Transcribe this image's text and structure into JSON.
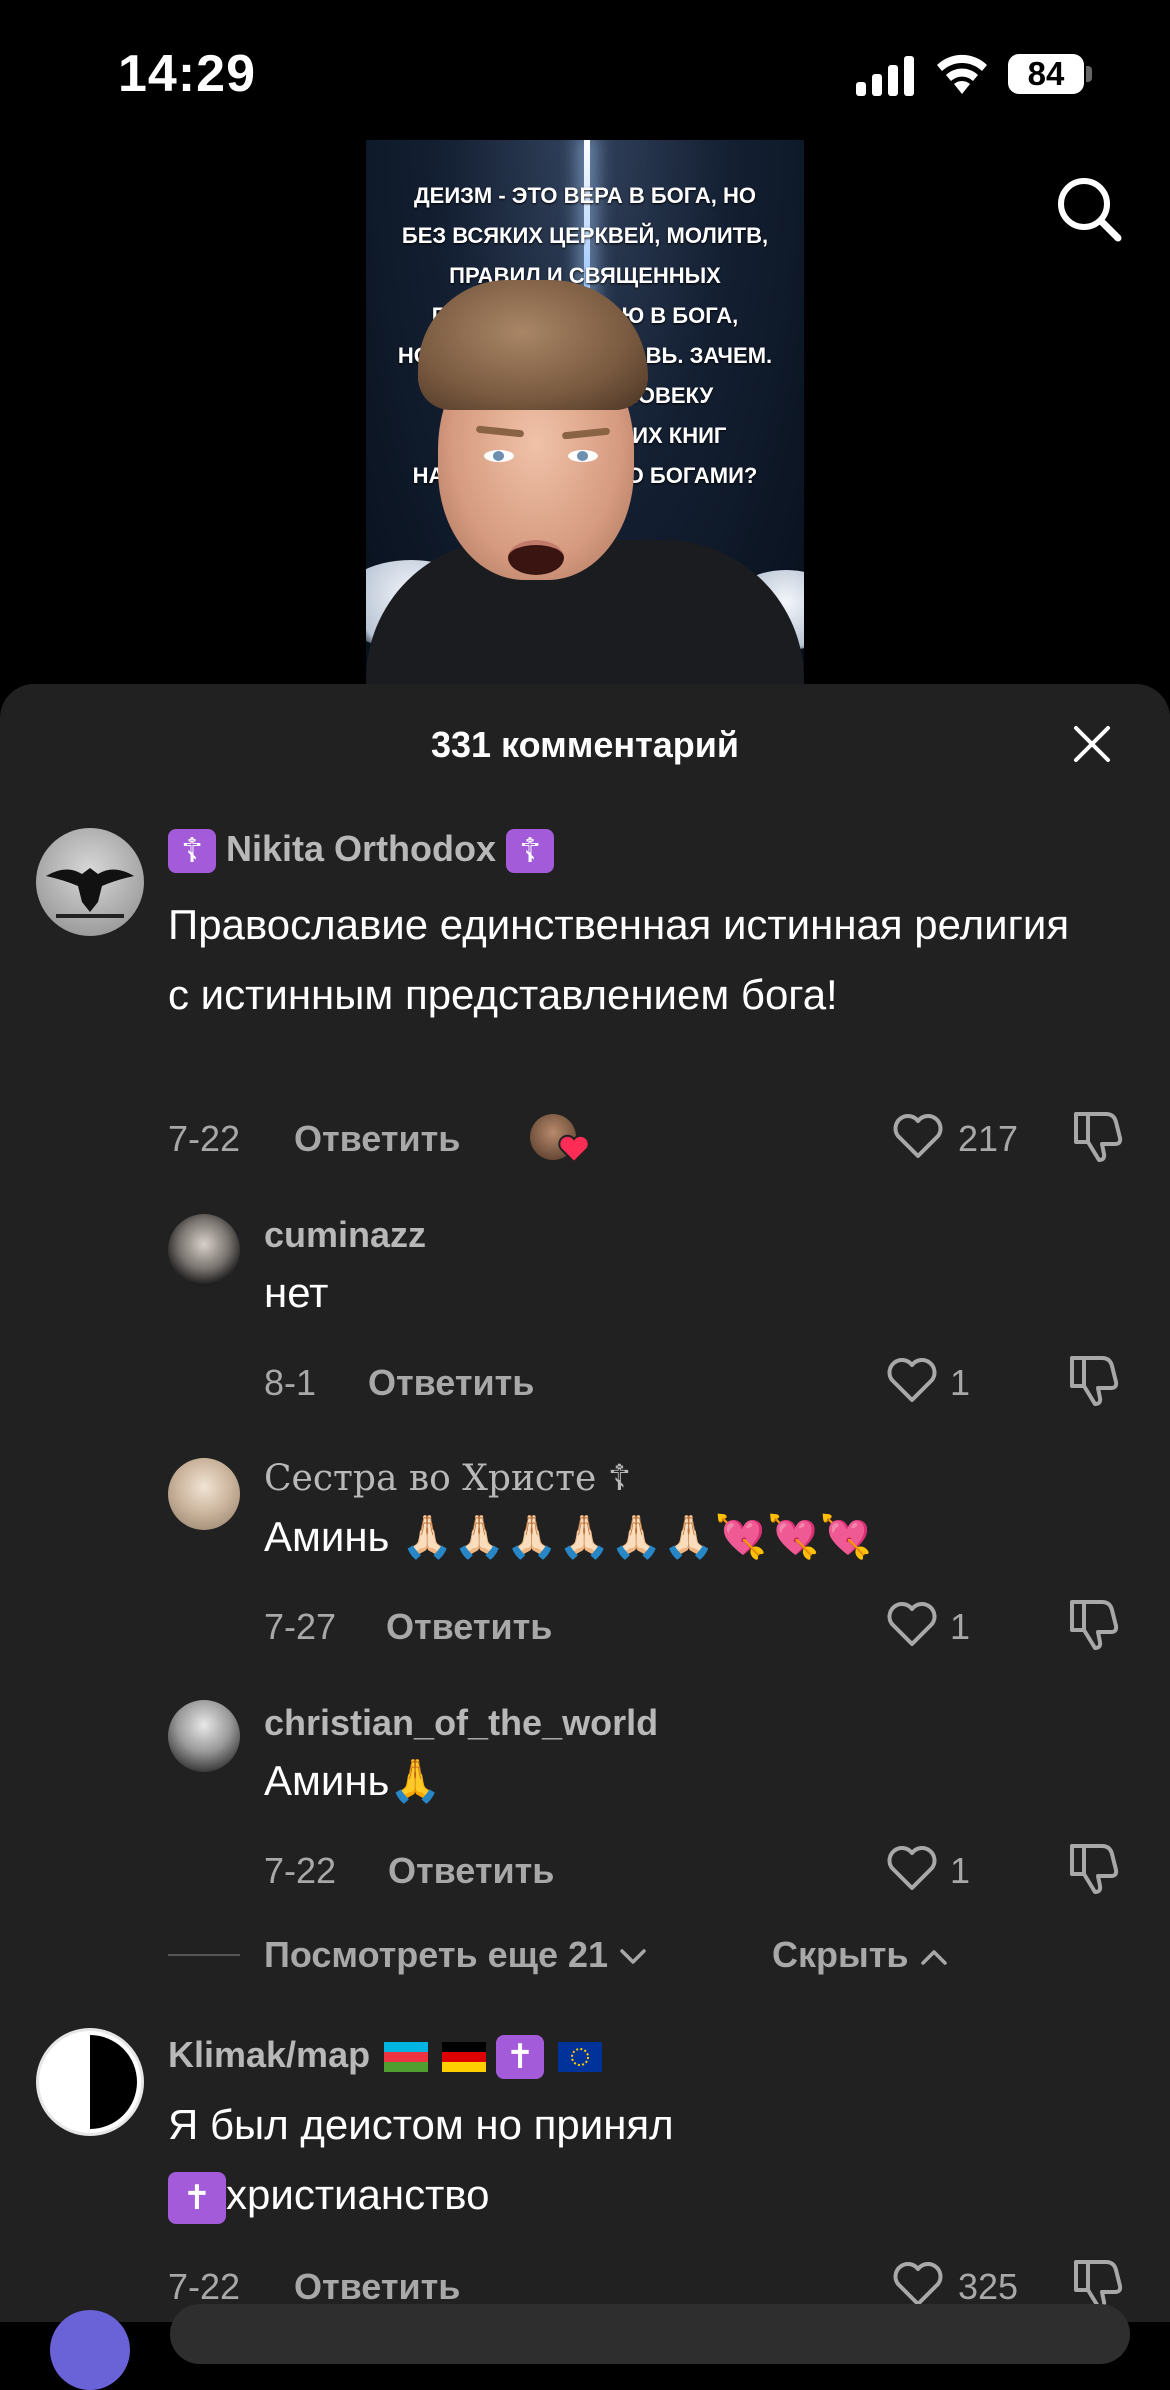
{
  "status_bar": {
    "time": "14:29",
    "battery": "84"
  },
  "video": {
    "overlay_lines": [
      "ДЕИЗМ - ЭТО ВЕРА В БОГА, НО",
      "БЕЗ ВСЯКИХ ЦЕРКВЕЙ, МОЛИТВ,",
      "ПРАВИЛ И СВЯЩЕННЫХ",
      "ПИСАНИЙ. Я ВЕРЮ В БОГА,",
      "НО НЕ ВЕРЮ В ЦЕРКОВЬ. ЗАЧЕМ.",
      "ОТКУДА ЖЕ ЧЕЛОВЕКУ",
      "ЗНАТЬ, ЧТО В ЭТИХ КНИГ",
      "НАПИСАНО ИМЕННО БОГАМИ?"
    ]
  },
  "comments_sheet": {
    "title": "331 комментарий",
    "comments": [
      {
        "username": "Nikita Orthodox",
        "username_prefix": "☦",
        "username_suffix": "☦",
        "text": "Православие единственная истинная религия с истинным представлением бога!",
        "date": "7-22",
        "reply_label": "Ответить",
        "likes": "217"
      },
      {
        "username": "cuminazz",
        "text": "нет",
        "date": "8-1",
        "reply_label": "Ответить",
        "likes": "1"
      },
      {
        "username": "Сестра во Христе ☦",
        "text": "Аминь 🙏🏻🙏🏻🙏🏻🙏🏻🙏🏻🙏🏻💘💘💘",
        "date": "7-27",
        "reply_label": "Ответить",
        "likes": "1"
      },
      {
        "username": "christian_of_the_world",
        "text": "Аминь🙏",
        "date": "7-22",
        "reply_label": "Ответить",
        "likes": "1"
      },
      {
        "username": "Klimak/map",
        "text_line1": "Я был деистом но принял",
        "text_line2": "христианство",
        "date": "7-22",
        "reply_label": "Ответить",
        "likes": "325"
      }
    ],
    "view_more": "Посмотреть еще 21",
    "hide": "Скрыть"
  },
  "colors": {
    "sheet_bg": "#212121",
    "muted_text": "#a8a8a8",
    "username": "#b8b8b8",
    "cross_badge": "#a35bd9",
    "like_heart": "#ff2c55"
  },
  "icons": [
    "search-icon",
    "close-icon",
    "heart-icon",
    "dislike-icon",
    "chevron-down-icon",
    "chevron-up-icon"
  ]
}
